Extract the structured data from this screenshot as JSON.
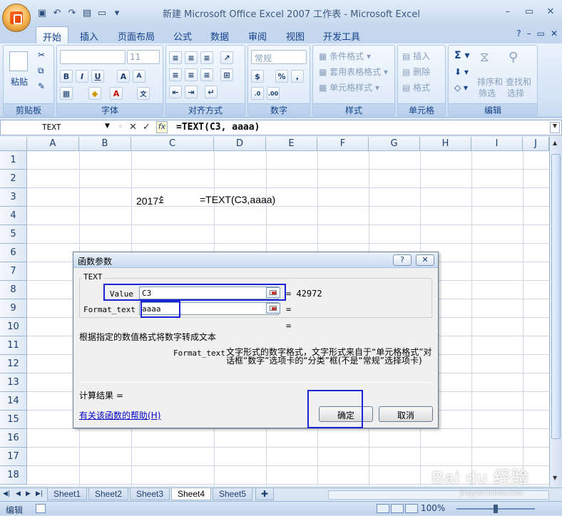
{
  "window": {
    "title": "新建 Microsoft Office Excel 2007 工作表 - Microsoft Excel"
  },
  "tabs": [
    {
      "label": "开始"
    },
    {
      "label": "插入"
    },
    {
      "label": "页面布局"
    },
    {
      "label": "公式"
    },
    {
      "label": "数据"
    },
    {
      "label": "审阅"
    },
    {
      "label": "视图"
    },
    {
      "label": "开发工具"
    }
  ],
  "ribbon": {
    "clipboard": {
      "label": "剪贴板",
      "paste": "粘贴"
    },
    "font": {
      "label": "字体",
      "font_size": "11"
    },
    "alignment": {
      "label": "对齐方式"
    },
    "number": {
      "label": "数字",
      "format": "常规"
    },
    "styles": {
      "label": "样式",
      "conditional": "条件格式",
      "table_format": "套用表格格式",
      "cell_styles": "单元格样式"
    },
    "cells": {
      "label": "单元格",
      "insert": "插入",
      "delete": "删除",
      "format": "格式"
    },
    "editing": {
      "label": "编辑",
      "sort_filter_1": "排序和",
      "sort_filter_2": "筛选",
      "find_select_1": "查找和",
      "find_select_2": "选择"
    }
  },
  "formula_bar": {
    "name_box": "TEXT",
    "formula": "=TEXT(C3, aaaa)"
  },
  "sheet": {
    "columns": [
      "A",
      "B",
      "C",
      "D",
      "E",
      "F",
      "G",
      "H",
      "I",
      "J"
    ],
    "rows": [
      "1",
      "2",
      "3",
      "4",
      "5",
      "6",
      "7",
      "8",
      "9",
      "10",
      "11",
      "12",
      "13",
      "14",
      "15",
      "16",
      "17",
      "18"
    ],
    "c3_value": "2017年",
    "e3_value": "=TEXT(C3,aaaa)"
  },
  "sheet_tabs": [
    "Sheet1",
    "Sheet2",
    "Sheet3",
    "Sheet4",
    "Sheet5"
  ],
  "status": {
    "mode": "编辑",
    "zoom": "100%"
  },
  "dialog": {
    "title": "函数参数",
    "function_name": "TEXT",
    "args": [
      {
        "label": "Value",
        "value": "C3",
        "result": "= 42972"
      },
      {
        "label": "Format_text",
        "value": "aaaa",
        "result": "="
      }
    ],
    "function_result": "=",
    "description": "根据指定的数值格式将数字转成文本",
    "arg_desc_label": "Format_text",
    "arg_desc": "文字形式的数字格式，文字形式来自于“单元格格式”对话框“数字”选项卡的“分类”框(不是“常规”选择项卡)",
    "result_label": "计算结果 =",
    "help_link": "有关该函数的帮助(H)",
    "ok": "确定",
    "cancel": "取消"
  },
  "watermark": {
    "text": "Bai du 经验",
    "url": "jingyan.baidu.com"
  }
}
